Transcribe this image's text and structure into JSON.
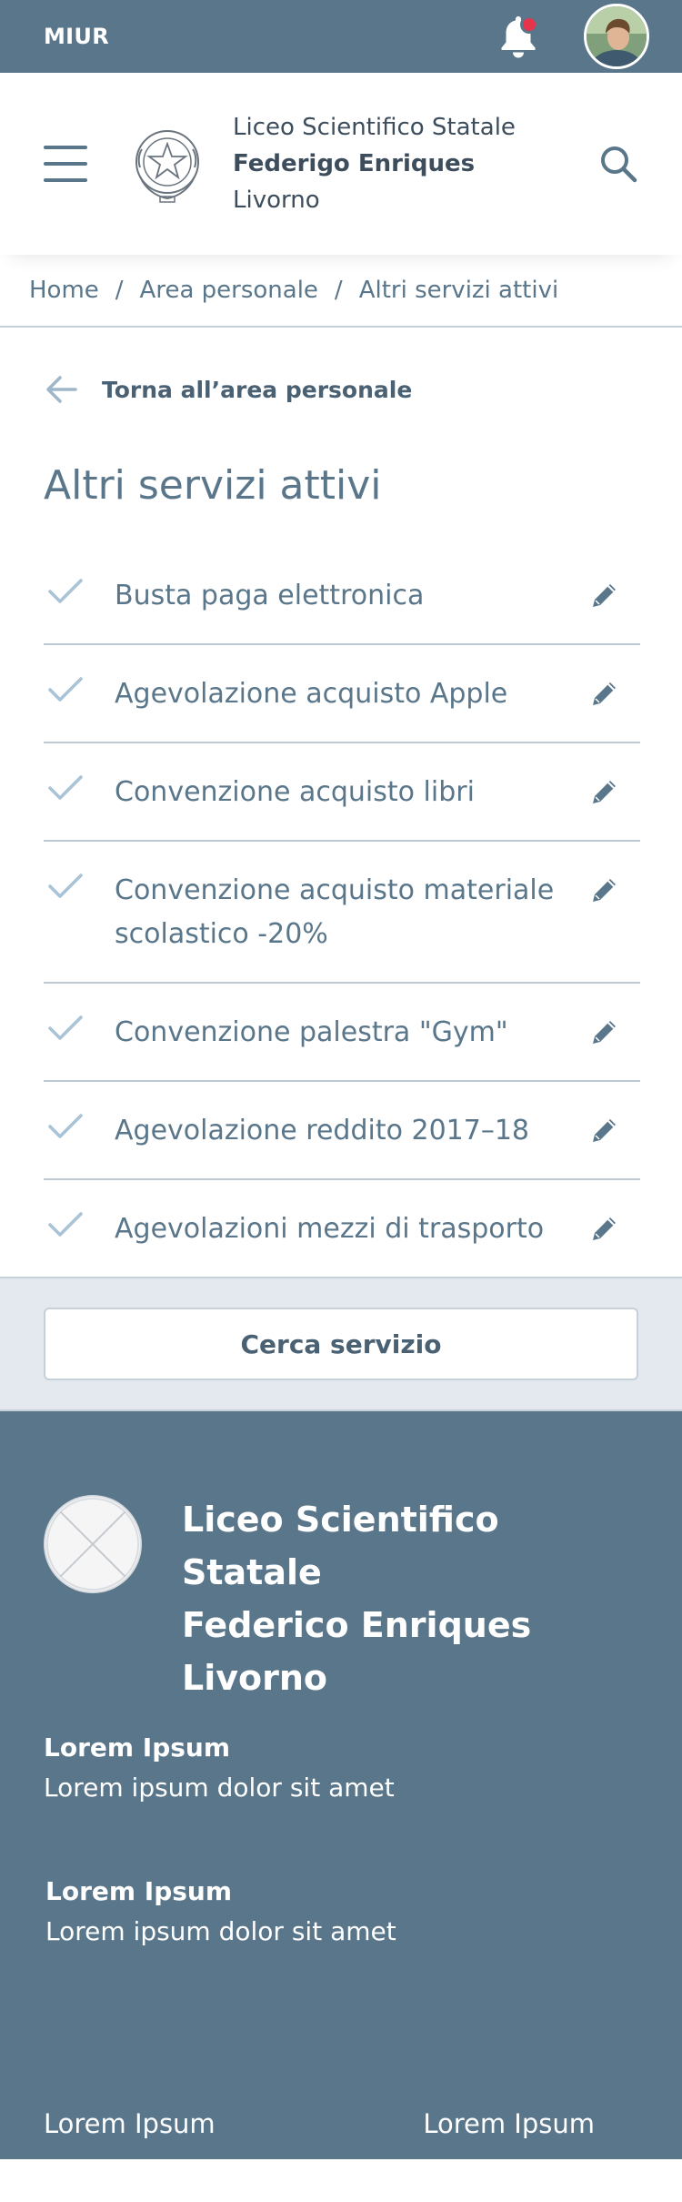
{
  "topbar": {
    "org": "MIUR",
    "notification_dot_color": "#e5344c"
  },
  "header": {
    "school_line1": "Liceo Scientifico Statale",
    "school_line2": "Federigo Enriques",
    "school_line3": "Livorno"
  },
  "breadcrumb": {
    "items": [
      "Home",
      "Area personale",
      "Altri servizi attivi"
    ],
    "separator": "/"
  },
  "back_link": {
    "label": "Torna all’area personale"
  },
  "page_title": "Altri servizi attivi",
  "services": [
    {
      "label": "Busta paga elettronica"
    },
    {
      "label": "Agevolazione acquisto Apple"
    },
    {
      "label": "Convenzione acquisto libri"
    },
    {
      "label": "Convenzione acquisto materiale scolastico -20%"
    },
    {
      "label": "Convenzione palestra \"Gym\""
    },
    {
      "label": "Agevolazione reddito 2017–18"
    },
    {
      "label": "Agevolazioni mezzi di trasporto"
    }
  ],
  "search_service_button": "Cerca servizio",
  "footer": {
    "name_line1": "Liceo Scientifico Statale",
    "name_line2": "Federico Enriques",
    "name_line3": "Livorno",
    "block1_title": "Lorem Ipsum",
    "block1_text": "Lorem ipsum dolor sit amet",
    "block2_title": "Lorem Ipsum",
    "block2_text": "Lorem ipsum dolor sit amet",
    "link_left": "Lorem Ipsum",
    "link_right": "Lorem Ipsum"
  },
  "colors": {
    "primary": "#5a768a",
    "alert": "#e5344c",
    "light_bg": "#e4e9f0"
  }
}
